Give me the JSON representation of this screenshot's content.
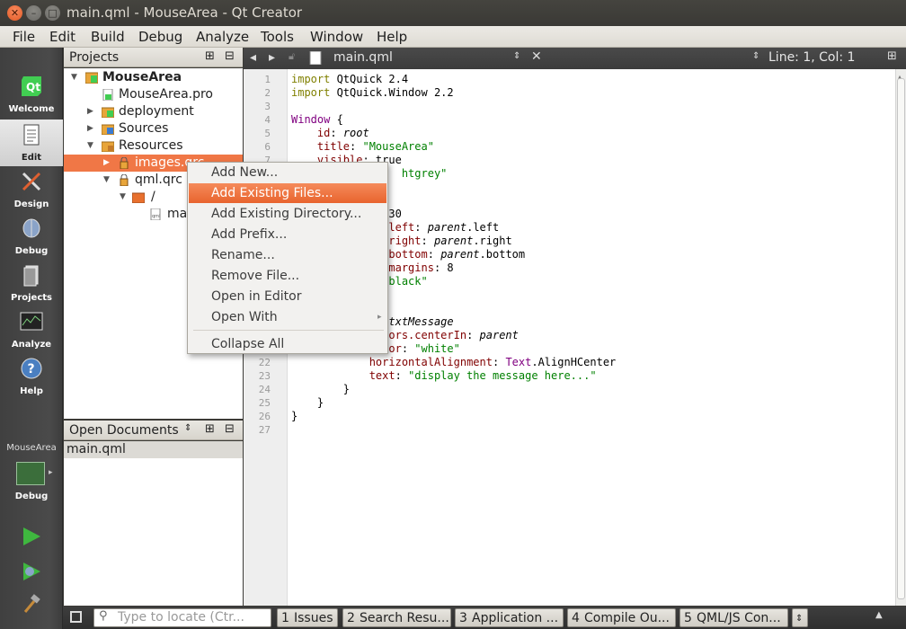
{
  "window": {
    "title": "main.qml - MouseArea - Qt Creator"
  },
  "menu": [
    "File",
    "Edit",
    "Build",
    "Debug",
    "Analyze",
    "Tools",
    "Window",
    "Help"
  ],
  "modes": [
    {
      "label": "Welcome",
      "icon": "qt-logo-icon"
    },
    {
      "label": "Edit",
      "icon": "document-icon"
    },
    {
      "label": "Design",
      "icon": "design-icon"
    },
    {
      "label": "Debug",
      "icon": "debug-bug-icon"
    },
    {
      "label": "Projects",
      "icon": "projects-icon"
    },
    {
      "label": "Analyze",
      "icon": "analyze-icon"
    },
    {
      "label": "Help",
      "icon": "help-icon"
    }
  ],
  "kit": {
    "project": "MouseArea",
    "build": "Debug"
  },
  "projects_pane": {
    "title": "Projects",
    "tree": [
      {
        "label": "MouseArea"
      },
      {
        "label": "MouseArea.pro"
      },
      {
        "label": "deployment"
      },
      {
        "label": "Sources"
      },
      {
        "label": "Resources"
      },
      {
        "label": "images.qrc"
      },
      {
        "label": "qml.qrc"
      },
      {
        "label": "/"
      },
      {
        "label": "main.qml"
      }
    ]
  },
  "open_documents": {
    "title": "Open Documents",
    "items": [
      "main.qml"
    ]
  },
  "editor": {
    "file": "main.qml",
    "position": "Line: 1, Col: 1",
    "line_numbers": [
      "1",
      "2",
      "3",
      "4",
      "5",
      "6",
      "7",
      "8",
      "9",
      "10",
      "11",
      "12",
      "13",
      "14",
      "15",
      "16",
      "17",
      "18",
      "19",
      "20",
      "21",
      "22",
      "23",
      "24",
      "25",
      "26",
      "27"
    ]
  },
  "context_menu": {
    "items": [
      "Add New...",
      "Add Existing Files...",
      "Add Existing Directory...",
      "Add Prefix...",
      "Rename...",
      "Remove File...",
      "Open in Editor",
      "Open With",
      "Collapse All"
    ],
    "highlighted": "Add Existing Files..."
  },
  "statusbar": {
    "locator_placeholder": "Type to locate (Ctr...",
    "tabs": [
      {
        "num": "1",
        "label": "Issues"
      },
      {
        "num": "2",
        "label": "Search Resu..."
      },
      {
        "num": "3",
        "label": "Application ..."
      },
      {
        "num": "4",
        "label": "Compile Ou..."
      },
      {
        "num": "5",
        "label": "QML/JS Con..."
      }
    ]
  },
  "colors": {
    "accent": "#f07746",
    "highlight": "#e8642e"
  }
}
